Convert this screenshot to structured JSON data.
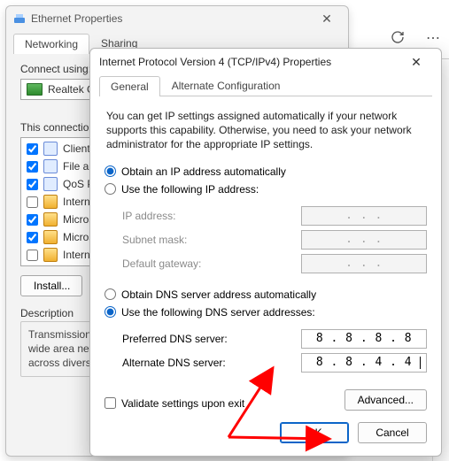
{
  "back_window": {
    "title": "Ethernet Properties",
    "tabs": [
      "Networking",
      "Sharing"
    ],
    "connect_using_label": "Connect using:",
    "adapter": "Realtek G",
    "items_label": "This connection",
    "items": [
      {
        "checked": true,
        "icon": "client",
        "label": "Client fo"
      },
      {
        "checked": true,
        "icon": "client",
        "label": "File and"
      },
      {
        "checked": true,
        "icon": "client",
        "label": "QoS Pa"
      },
      {
        "checked": false,
        "icon": "net",
        "label": "Interne"
      },
      {
        "checked": true,
        "icon": "net",
        "label": "Microso"
      },
      {
        "checked": true,
        "icon": "net",
        "label": "Microso"
      },
      {
        "checked": false,
        "icon": "net",
        "label": "Interne"
      }
    ],
    "install_btn": "Install...",
    "description_title": "Description",
    "description_text": "Transmission\nwide area net\nacross diverse"
  },
  "front_window": {
    "title": "Internet Protocol Version 4 (TCP/IPv4) Properties",
    "tabs": [
      "General",
      "Alternate Configuration"
    ],
    "intro": "You can get IP settings assigned automatically if your network supports this capability. Otherwise, you need to ask your network administrator for the appropriate IP settings.",
    "ip": {
      "auto_label": "Obtain an IP address automatically",
      "manual_label": "Use the following IP address:",
      "selected": "auto",
      "fields": {
        "ip_label": "IP address:",
        "subnet_label": "Subnet mask:",
        "gateway_label": "Default gateway:",
        "ip_value": "   .       .       .",
        "subnet_value": "   .       .       .",
        "gateway_value": "   .       .       ."
      }
    },
    "dns": {
      "auto_label": "Obtain DNS server address automatically",
      "manual_label": "Use the following DNS server addresses:",
      "selected": "manual",
      "preferred_label": "Preferred DNS server:",
      "alternate_label": "Alternate DNS server:",
      "preferred_value": "8 . 8 . 8 . 8",
      "alternate_value": "8 . 8 . 4 . 4"
    },
    "validate_label": "Validate settings upon exit",
    "validate_checked": false,
    "advanced_btn": "Advanced...",
    "ok_btn": "OK",
    "cancel_btn": "Cancel"
  },
  "annotation": {
    "color": "#ff0000"
  }
}
